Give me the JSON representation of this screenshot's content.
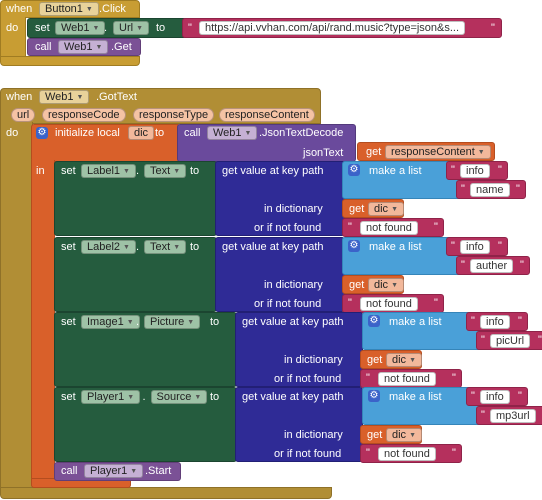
{
  "event1": {
    "when": "when",
    "component": "Button1",
    "event": ".Click",
    "do": "do",
    "set_kw": "set",
    "set_component": "Web1",
    "dot": ".",
    "set_property": "Url",
    "to": "to",
    "url_value": "https://api.vvhan.com/api/rand.music?type=json&s...",
    "call_kw": "call",
    "call_component": "Web1",
    "call_method": ".Get"
  },
  "event2": {
    "when": "when",
    "component": "Web1",
    "event": ".GotText",
    "params": [
      "url",
      "responseCode",
      "responseType",
      "responseContent"
    ],
    "do": "do",
    "init_local": "initialize local",
    "local_name": "dic",
    "to": "to",
    "call_kw": "call",
    "decode_component": "Web1",
    "decode_method": ".JsonTextDecode",
    "json_text_label": "jsonText",
    "get_kw": "get",
    "get_param": "responseContent",
    "in_kw": "in",
    "setters": [
      {
        "component": "Label1",
        "property": "Text",
        "keys": [
          "info",
          "name"
        ]
      },
      {
        "component": "Label2",
        "property": "Text",
        "keys": [
          "info",
          "auther"
        ]
      },
      {
        "component": "Image1",
        "property": "Picture",
        "keys": [
          "info",
          "picUrl"
        ]
      },
      {
        "component": "Player1",
        "property": "Source",
        "keys": [
          "info",
          "mp3url"
        ]
      }
    ],
    "set_kw": "set",
    "dot": ".",
    "get_value_label": "get value at key path",
    "make_list_label": "make a list",
    "in_dictionary_label": "in dictionary",
    "or_if_not_found_label": "or if not found",
    "get_dic_kw": "get",
    "dic_var": "dic",
    "not_found_value": "not found",
    "final_call_kw": "call",
    "final_component": "Player1",
    "final_method": ".Start"
  },
  "colors": {
    "event": "#c89d33",
    "setter": "#255c3e",
    "method": "#7b5196",
    "dictionary": "#2f2b96",
    "list": "#4aa0d8",
    "variable": "#d9602a",
    "text": "#b5305d"
  },
  "icons": [
    "gear-icon",
    "dropdown-arrow-icon"
  ]
}
